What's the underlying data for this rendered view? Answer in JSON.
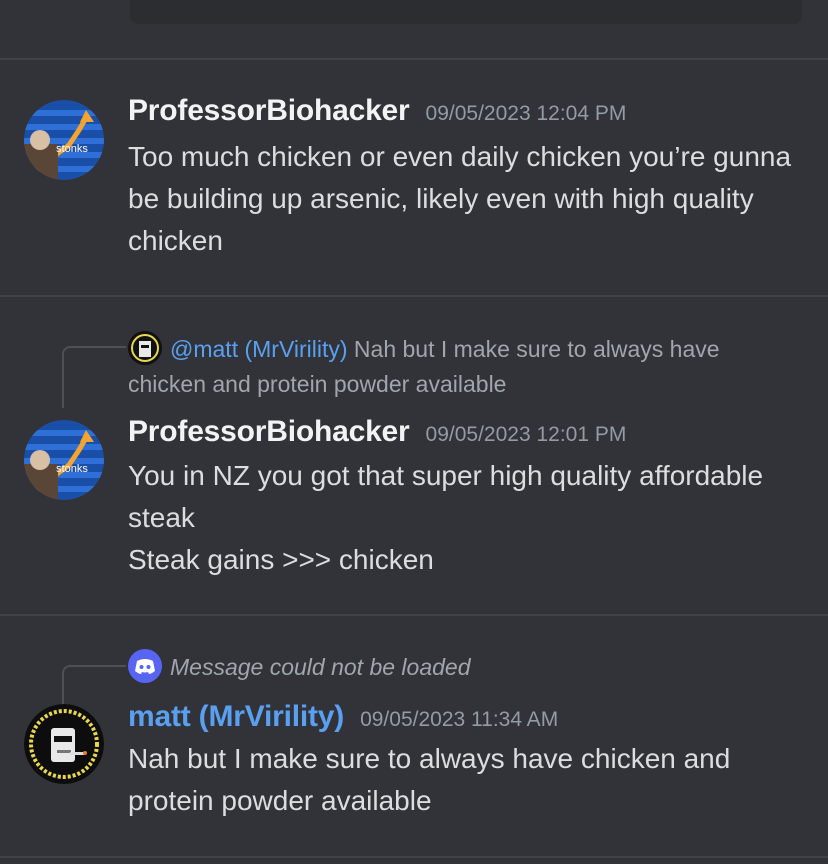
{
  "messages": [
    {
      "author": "ProfessorBiohacker",
      "timestamp": "09/05/2023 12:04 PM",
      "lines": [
        "Too much chicken or even daily chicken you’re gunna be building up arsenic, likely even with high quality chicken"
      ],
      "avatar_icon": "stonks-avatar"
    },
    {
      "reply_to": {
        "mention": "@matt (MrVirility)",
        "text": "Nah but I make sure to always have chicken and protein powder available"
      },
      "author": "ProfessorBiohacker",
      "timestamp": "09/05/2023 12:01 PM",
      "lines": [
        "You in NZ you got that super high quality affordable steak",
        "Steak gains >>> chicken"
      ],
      "avatar_icon": "stonks-avatar"
    },
    {
      "reply_to": {
        "text": "Message could not be loaded",
        "icon": "discord-icon"
      },
      "author": "matt (MrVirility)",
      "timestamp": "09/05/2023 11:34 AM",
      "lines": [
        "Nah but I make sure to always have chicken and protein powder available"
      ],
      "avatar_icon": "matt-avatar"
    }
  ],
  "colors": {
    "background": "#313338",
    "author_default": "#f2f3f5",
    "author_blue": "#5aa0f0",
    "timestamp": "#949ba4",
    "discord": "#5865f2"
  }
}
